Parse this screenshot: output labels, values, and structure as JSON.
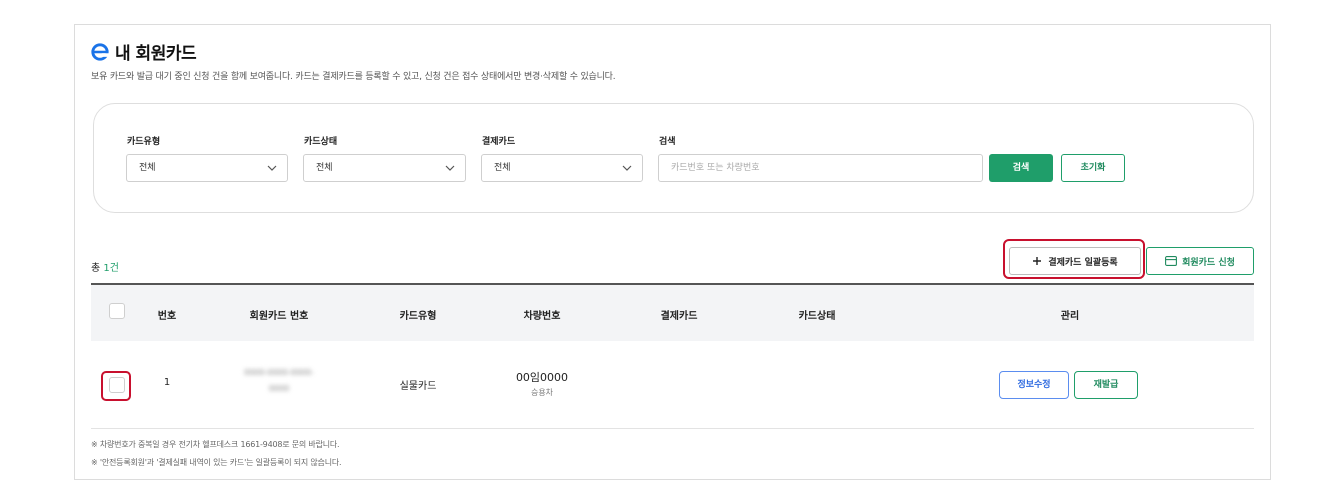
{
  "header": {
    "title": "내 회원카드",
    "description": "보유 카드와 발급 대기 중인 신청 건을 함께 보여줍니다. 카드는 결제카드를 등록할 수 있고, 신청 건은 접수 상태에서만 변경·삭제할 수 있습니다."
  },
  "filters": {
    "card_type": {
      "label": "카드유형",
      "value": "전체"
    },
    "card_status": {
      "label": "카드상태",
      "value": "전체"
    },
    "payment_card": {
      "label": "결제카드",
      "value": "전체"
    },
    "search": {
      "label": "검색",
      "placeholder": "카드번호 또는 차량번호",
      "value": ""
    },
    "search_button": "검색",
    "reset_button": "초기화"
  },
  "summary": {
    "total_prefix": "총",
    "total_count": "1건"
  },
  "actions": {
    "bulk_register": "결제카드 일괄등록",
    "apply_card": "회원카드 신청"
  },
  "table": {
    "columns": [
      "번호",
      "회원카드 번호",
      "카드유형",
      "차량번호",
      "결제카드",
      "카드상태",
      "관리"
    ],
    "rows": [
      {
        "no": "1",
        "card_number_line1": "0000-0000-0000-",
        "card_number_line2": "0000",
        "card_type": "실물카드",
        "vehicle_number": "00임0000",
        "vehicle_type": "승용차",
        "payment_card": "",
        "status": "",
        "edit_label": "정보수정",
        "reissue_label": "재발급"
      }
    ]
  },
  "notes": [
    "※ 차량번호가 중복일 경우 전기차 헬프데스크 1661-9408로 문의 바랍니다.",
    "※ '안전등록회원'과 '결제실패 내역이 있는 카드'는 일괄등록이 되지 않습니다."
  ],
  "colors": {
    "accent": "#1f9e6a",
    "highlight": "#c8102e",
    "edit": "#2f6be0"
  }
}
